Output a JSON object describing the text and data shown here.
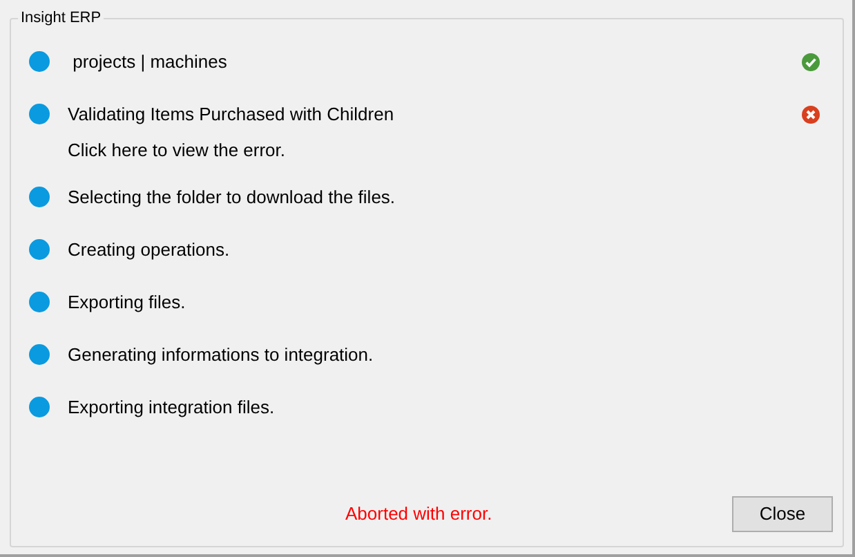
{
  "group_title": "Insight ERP",
  "steps": [
    {
      "label": " projects | machines",
      "kind": "success"
    },
    {
      "label": "Validating Items Purchased with Children",
      "kind": "error",
      "link": "Click here to view the error."
    },
    {
      "label": "Selecting the folder to download the files.",
      "kind": "pending"
    },
    {
      "label": "Creating operations.",
      "kind": "pending"
    },
    {
      "label": "Exporting files.",
      "kind": "pending"
    },
    {
      "label": "Generating informations to integration.",
      "kind": "pending"
    },
    {
      "label": "Exporting integration files.",
      "kind": "pending"
    }
  ],
  "status_message": "Aborted with error.",
  "close_button": "Close"
}
